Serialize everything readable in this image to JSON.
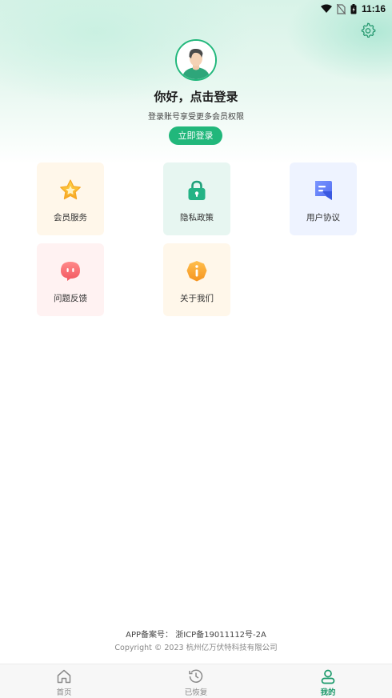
{
  "status_bar": {
    "time": "11:16"
  },
  "profile": {
    "greeting": "你好，点击登录",
    "subtitle": "登录账号享受更多会员权限",
    "login_button": "立即登录"
  },
  "menu": [
    {
      "label": "会员服务",
      "icon": "star-icon"
    },
    {
      "label": "隐私政策",
      "icon": "lock-icon"
    },
    {
      "label": "用户协议",
      "icon": "document-icon"
    },
    {
      "label": "问题反馈",
      "icon": "chat-icon"
    },
    {
      "label": "关于我们",
      "icon": "info-icon"
    }
  ],
  "footer": {
    "icp": "APP备案号：  浙ICP备19011112号-2A",
    "copyright": "Copyright © 2023 杭州亿万伏特科技有限公司"
  },
  "tabbar": {
    "tabs": [
      {
        "label": "首页",
        "icon": "home-icon"
      },
      {
        "label": "已恢复",
        "icon": "history-icon"
      },
      {
        "label": "我的",
        "icon": "user-icon"
      }
    ],
    "active_index": 2
  },
  "colors": {
    "brand": "#21b77b",
    "active_tab": "#1c9a6b"
  }
}
